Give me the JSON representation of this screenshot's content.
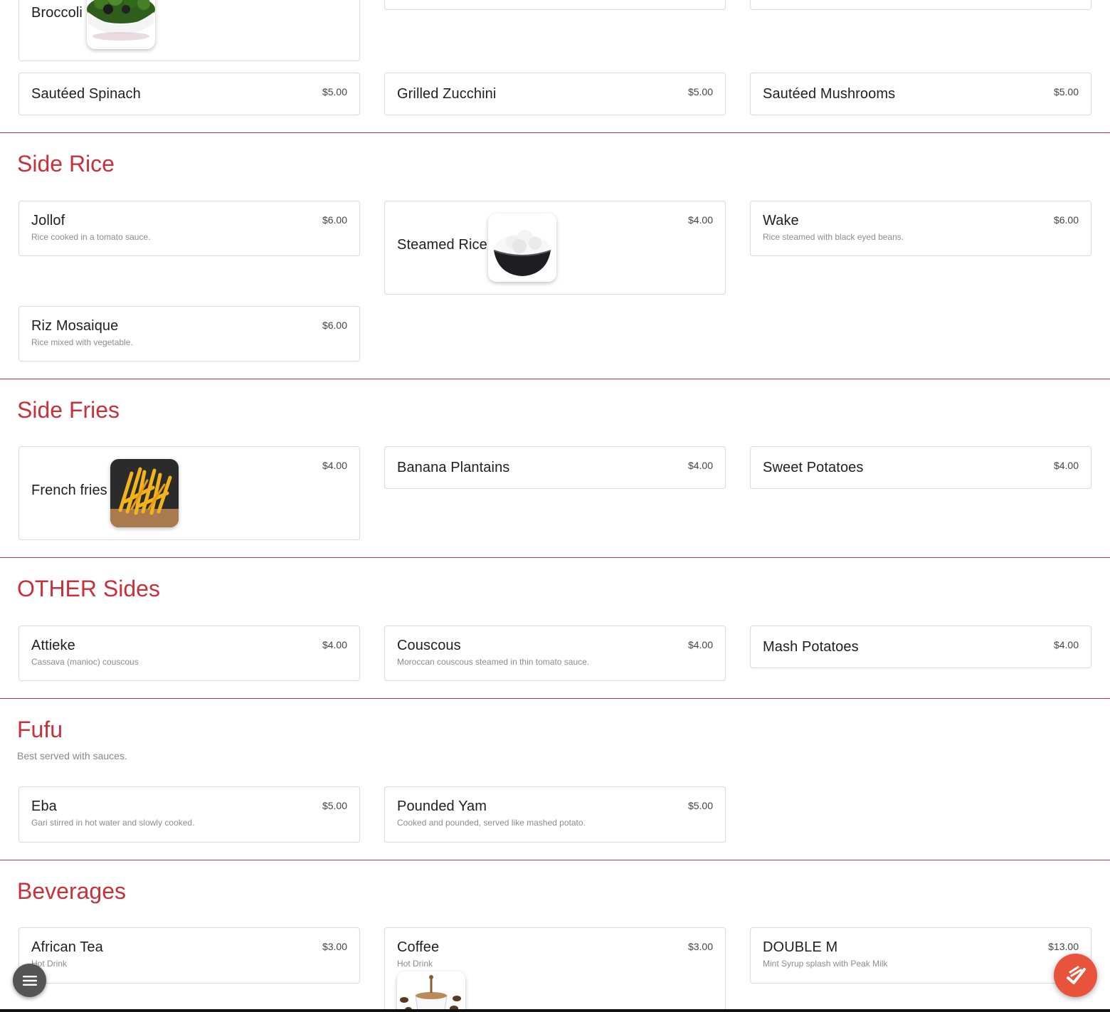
{
  "colors": {
    "accent": "#c8313a",
    "fab_right": "#e8533c",
    "fab_left": "#555555"
  },
  "vegetables": {
    "items": [
      {
        "name": "Broccoli",
        "price": "",
        "image": "broccoli-bowl"
      },
      {
        "name": "Sautéed Spinach",
        "price": "$5.00"
      },
      {
        "name": "Grilled Zucchini",
        "price": "$5.00"
      },
      {
        "name": "Sautéed Mushrooms",
        "price": "$5.00"
      }
    ]
  },
  "sections": [
    {
      "title": "Side Rice",
      "items": [
        {
          "name": "Jollof",
          "desc": "Rice cooked in a tomato sauce.",
          "price": "$6.00"
        },
        {
          "name": "Steamed Rice",
          "desc": "",
          "price": "$4.00",
          "image": "rice-bowl"
        },
        {
          "name": "Wake",
          "desc": "Rice steamed with black eyed beans.",
          "price": "$6.00"
        },
        {
          "name": "Riz Mosaique",
          "desc": "Rice mixed with vegetable.",
          "price": "$6.00"
        }
      ]
    },
    {
      "title": "Side Fries",
      "items": [
        {
          "name": "French fries",
          "desc": "",
          "price": "$4.00",
          "image": "french-fries"
        },
        {
          "name": "Banana Plantains",
          "desc": "",
          "price": "$4.00"
        },
        {
          "name": "Sweet Potatoes",
          "desc": "",
          "price": "$4.00"
        }
      ]
    },
    {
      "title": "OTHER Sides",
      "items": [
        {
          "name": "Attieke",
          "desc": "Cassava (manioc) couscous",
          "price": "$4.00"
        },
        {
          "name": "Couscous",
          "desc": "Moroccan couscous steamed in thin tomato sauce.",
          "price": "$4.00"
        },
        {
          "name": "Mash Potatoes",
          "desc": "",
          "price": "$4.00"
        }
      ]
    },
    {
      "title": "Fufu",
      "subtitle": "Best served with sauces.",
      "items": [
        {
          "name": "Eba",
          "desc": "Gari stirred in hot water and slowly cooked.",
          "price": "$5.00"
        },
        {
          "name": "Pounded Yam",
          "desc": "Cooked and pounded, served like mashed potato.",
          "price": "$5.00"
        }
      ]
    },
    {
      "title": "Beverages",
      "items": [
        {
          "name": "African Tea",
          "desc": "Hot Drink",
          "price": "$3.00"
        },
        {
          "name": "Coffee",
          "desc": "Hot Drink",
          "price": "$3.00",
          "image": "coffee-cup"
        },
        {
          "name": "DOUBLE M",
          "desc": "Mint Syrup splash with Peak Milk",
          "price": "$13.00"
        }
      ]
    }
  ],
  "icons": {
    "menu_button": "hamburger-icon",
    "order_button": "order-check-icon"
  }
}
